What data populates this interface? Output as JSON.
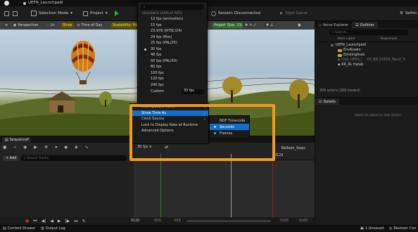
{
  "titlebar": {
    "project_name": "UEFN_LaunchpadI"
  },
  "toolbar": {
    "selection_mode": "Selection Mode",
    "project": "Project",
    "session": "Session Disconnected",
    "start_game": "Start Game",
    "settings": "Settin"
  },
  "viewport": {
    "perspective": "Perspective",
    "lit": "Lit",
    "show": "Show",
    "time_of_day": "Time of Day",
    "scalability": "Scalability: Hig",
    "project_size": "Project Size: 1%"
  },
  "outliner": {
    "tabs": [
      "Verse Explorer",
      "Outliner"
    ],
    "search_placeholder": "Search...",
    "column_item": "Item Label",
    "column_type": "Sequencer",
    "rows": [
      {
        "label": "UEFN_LaunchpadI",
        "type": "",
        "grey": false
      },
      {
        "label": "EnvAssets",
        "type": "",
        "grey": false
      },
      {
        "label": "ExistingAsse",
        "type": "",
        "grey": false
      },
      {
        "label": "DSA_UEFN_I",
        "type": "DS_BR_Ch501_Rend_Ti",
        "grey": true
      },
      {
        "label": "RR_RL Hatab",
        "type": "",
        "grey": false
      }
    ],
    "footer": "309 actors (309 loaded)"
  },
  "details": {
    "tab": "Details",
    "empty_text": "Select an object to view details."
  },
  "fps_menu": {
    "header": "SEQUENCE DISPLAY RATE",
    "items": [
      "12 fps (animation)",
      "15 fps",
      "23.976 (NTSC/24)",
      "24 fps (film)",
      "25 fps (PAL/25)",
      "30 fps",
      "48 fps",
      "50 fps (PAL/50)",
      "60 fps",
      "100 fps",
      "120 fps",
      "240 fps"
    ],
    "selected_index": 5,
    "custom_label": "Custom",
    "custom_value": "30 fps"
  },
  "sub_menu": {
    "items": [
      {
        "label": "Incompatible Rates",
        "arrow": true,
        "highlight": false
      },
      {
        "label": "Show Time As",
        "arrow": true,
        "highlight": true
      },
      {
        "label": "Clock Source",
        "arrow": true,
        "highlight": false
      },
      {
        "label": "Lock to Display Rate at Runtime",
        "arrow": false,
        "highlight": false
      },
      {
        "label": "Advanced Options",
        "arrow": false,
        "highlight": false
      }
    ]
  },
  "time_menu": {
    "items": [
      {
        "label": "NDF Timecode",
        "selected": false
      },
      {
        "label": "Seconds",
        "selected": true
      },
      {
        "label": "Frames",
        "selected": false
      }
    ]
  },
  "sequencer": {
    "tab": "Sequencer",
    "add_label": "+ Add",
    "search_placeholder": "Search Tracks",
    "fps_value": "30 fps",
    "sequence_name": "Balloon_Sequ",
    "frame_current": "0123",
    "frame_start": "0120",
    "frame_neg": "-015",
    "frame_neg2": "-015",
    "frame_end": "0165",
    "frame_end2": "0165"
  },
  "statusbar": {
    "content_drawer": "Content Drawer",
    "output_log": "Output Log",
    "unsaved": "1 Unsaved",
    "revision": "Revision Con"
  }
}
